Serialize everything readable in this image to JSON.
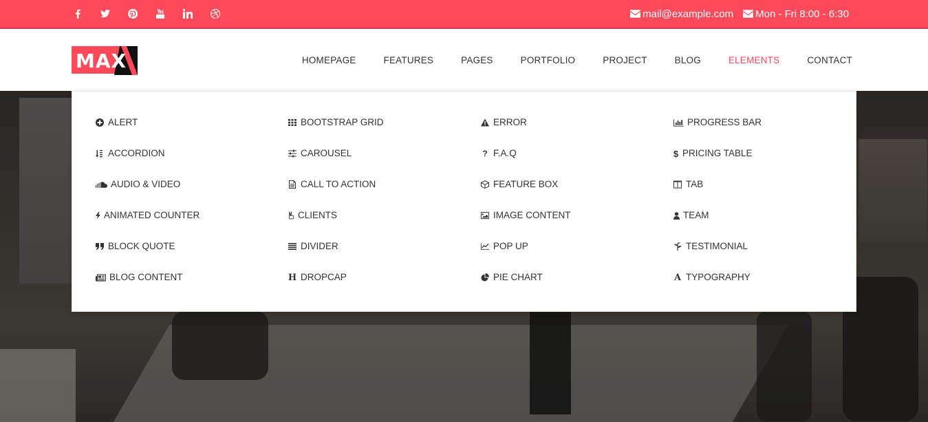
{
  "topbar": {
    "social": [
      "facebook-icon",
      "twitter-icon",
      "pinterest-icon",
      "youtube-icon",
      "linkedin-icon",
      "dribbble-icon"
    ],
    "email": "mail@example.com",
    "hours": "Mon - Fri 8:00 - 6:30",
    "color": "#fc4a5a"
  },
  "header": {
    "logo": "MAX",
    "nav": [
      "HOMEPAGE",
      "FEATURES",
      "PAGES",
      "PORTFOLIO",
      "PROJECT",
      "BLOG",
      "ELEMENTS",
      "CONTACT"
    ],
    "active": "ELEMENTS"
  },
  "mega_menu": {
    "columns": [
      [
        {
          "label": "ALERT",
          "icon": "plus-circle-icon"
        },
        {
          "label": "ACCORDION",
          "icon": "sort-alpha-icon"
        },
        {
          "label": "AUDIO & VIDEO",
          "icon": "soundcloud-icon"
        },
        {
          "label": "ANIMATED COUNTER",
          "icon": "bolt-icon"
        },
        {
          "label": "BLOCK QUOTE",
          "icon": "quote-icon"
        },
        {
          "label": "BLOG CONTENT",
          "icon": "newspaper-icon"
        }
      ],
      [
        {
          "label": "BOOTSTRAP GRID",
          "icon": "grid-icon"
        },
        {
          "label": "CAROUSEL",
          "icon": "sliders-icon"
        },
        {
          "label": "CALL TO ACTION",
          "icon": "file-text-icon"
        },
        {
          "label": "CLIENTS",
          "icon": "peace-hand-icon"
        },
        {
          "label": "DIVIDER",
          "icon": "bars-icon"
        },
        {
          "label": "DROPCAP",
          "icon": "header-icon"
        }
      ],
      [
        {
          "label": "ERROR",
          "icon": "warning-icon"
        },
        {
          "label": "F.A.Q",
          "icon": "question-icon"
        },
        {
          "label": "FEATURE BOX",
          "icon": "cube-icon"
        },
        {
          "label": "IMAGE CONTENT",
          "icon": "image-icon"
        },
        {
          "label": "POP UP",
          "icon": "line-chart-icon"
        },
        {
          "label": "PIE CHART",
          "icon": "pie-chart-icon"
        }
      ],
      [
        {
          "label": "PROGRESS BAR",
          "icon": "bar-chart-icon"
        },
        {
          "label": "PRICING TABLE",
          "icon": "dollar-icon"
        },
        {
          "label": "TAB",
          "icon": "columns-icon"
        },
        {
          "label": "TEAM",
          "icon": "user-icon"
        },
        {
          "label": "TESTIMONIAL",
          "icon": "pagelines-icon"
        },
        {
          "label": "TYPOGRAPHY",
          "icon": "font-icon"
        }
      ]
    ]
  }
}
